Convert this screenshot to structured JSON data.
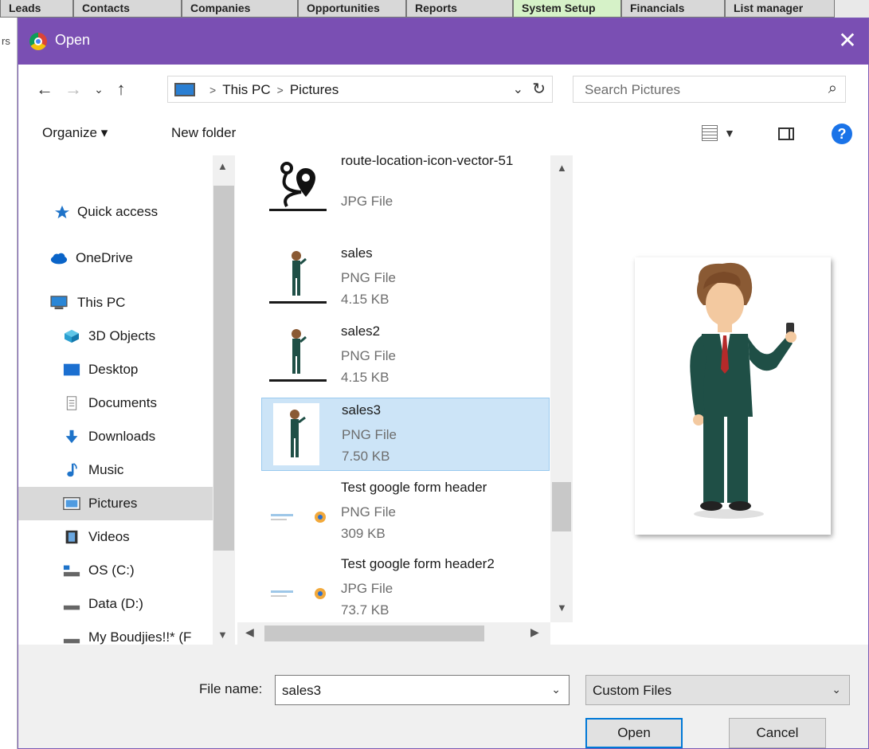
{
  "background_nav": {
    "tabs": [
      "Leads",
      "Contacts",
      "Companies",
      "Opportunities",
      "Reports",
      "System Setup",
      "Financials",
      "List manager"
    ],
    "active_tab": "System Setup",
    "left_fragment": "rs"
  },
  "dialog": {
    "title": "Open",
    "close_glyph": "✕"
  },
  "address": {
    "crumbs": [
      "This PC",
      "Pictures"
    ],
    "search_placeholder": "Search Pictures"
  },
  "toolbar": {
    "organize_label": "Organize ▾",
    "new_folder_label": "New folder",
    "help_glyph": "?"
  },
  "nav_pane": {
    "items": [
      {
        "label": "Quick access",
        "icon": "star-icon"
      },
      {
        "label": "OneDrive",
        "icon": "cloud-icon"
      },
      {
        "label": "This PC",
        "icon": "computer-icon"
      },
      {
        "label": "3D Objects",
        "icon": "cube-icon"
      },
      {
        "label": "Desktop",
        "icon": "desktop-icon"
      },
      {
        "label": "Documents",
        "icon": "document-icon"
      },
      {
        "label": "Downloads",
        "icon": "download-arrow-icon"
      },
      {
        "label": "Music",
        "icon": "music-note-icon"
      },
      {
        "label": "Pictures",
        "icon": "pictures-icon"
      },
      {
        "label": "Videos",
        "icon": "film-icon"
      },
      {
        "label": "OS (C:)",
        "icon": "drive-icon"
      },
      {
        "label": "Data (D:)",
        "icon": "drive-icon"
      },
      {
        "label": "My Boudjies!!* (F",
        "icon": "drive-icon"
      }
    ],
    "selected": "Pictures"
  },
  "files": [
    {
      "name": "route-location-icon-vector-51",
      "type": "JPG File",
      "size": "",
      "thumb": "route-icon"
    },
    {
      "name": "sales",
      "type": "PNG File",
      "size": "4.15 KB",
      "thumb": "person-icon"
    },
    {
      "name": "sales2",
      "type": "PNG File",
      "size": "4.15 KB",
      "thumb": "person-icon"
    },
    {
      "name": "sales3",
      "type": "PNG File",
      "size": "7.50 KB",
      "thumb": "person-icon"
    },
    {
      "name": "Test google form header",
      "type": "PNG File",
      "size": "309 KB",
      "thumb": "banner-icon"
    },
    {
      "name": "Test google form header2",
      "type": "JPG File",
      "size": "73.7 KB",
      "thumb": "banner-icon"
    }
  ],
  "selected_file": "sales3",
  "footer": {
    "file_name_label": "File name:",
    "file_name_value": "sales3",
    "file_type_value": "Custom Files",
    "open_label": "Open",
    "cancel_label": "Cancel"
  },
  "colors": {
    "titlebar": "#7a4fb3",
    "selection": "#cce4f7",
    "primary_border": "#0078d7"
  }
}
